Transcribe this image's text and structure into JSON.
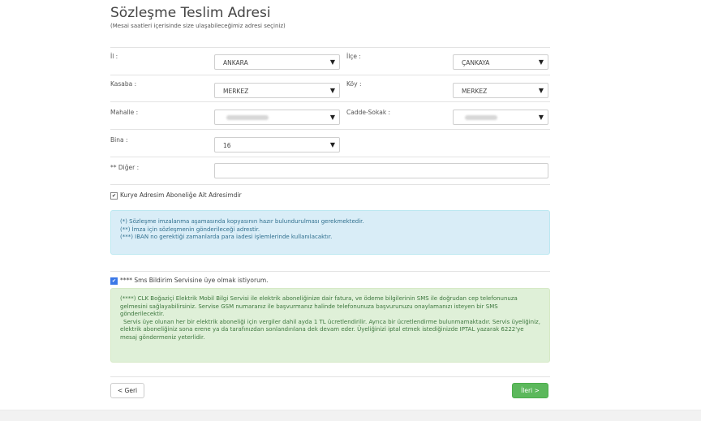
{
  "title": "Sözleşme Teslim Adresi",
  "subtitle": "(Mesai saatleri içerisinde size ulaşabileceğimiz adresi seçiniz)",
  "fields": {
    "il": {
      "label": "İl :",
      "value": "ANKARA"
    },
    "ilce": {
      "label": "İlçe :",
      "value": "ÇANKAYA"
    },
    "kasaba": {
      "label": "Kasaba :",
      "value": "MERKEZ"
    },
    "koy": {
      "label": "Köy :",
      "value": "MERKEZ"
    },
    "mahalle": {
      "label": "Mahalle :",
      "value": ""
    },
    "cadde": {
      "label": "Cadde-Sokak :",
      "value": ""
    },
    "bina": {
      "label": "Bina :",
      "value": "16"
    },
    "diger": {
      "label": "** Diğer :",
      "value": ""
    }
  },
  "kurye_checkbox": {
    "label": "Kurye Adresim Aboneliğe Ait Adresimdir",
    "checked": true
  },
  "info_lines": [
    "(*) Sözleşme imzalanma aşamasında kopyasının hazır bulundurulması gerekmektedir.",
    "(**) İmza için sözleşmenin gönderileceği adrestir.",
    "(***) IBAN no gerektiği zamanlarda para iadesi işlemlerinde kullanılacaktır."
  ],
  "sms_checkbox": {
    "label": "**** Sms Bildirim Servisine üye olmak istiyorum.",
    "checked": true
  },
  "sms_text_1": "(****) CLK Boğaziçi Elektrik Mobil Bilgi Servisi ile elektrik aboneliğinize dair fatura, ve ödeme bilgilerinin SMS ile doğrudan cep telefonunuza gelmesini sağlayabilirsiniz. Servise GSM numaranız ile başvurmanız halinde telefonunuza başvurunuzu onaylamanızı isteyen bir SMS gönderilecektir.",
  "sms_text_2": "Servis üye olunan her bir elektrik aboneliği için vergiler dahil ayda 1 TL ücretlendirilir. Ayrıca bir ücretlendirme bulunmamaktadır. Servis üyeliğiniz, elektrik aboneliğiniz sona erene ya da tarafınızdan sonlandırılana dek devam eder. Üyeliğinizi iptal etmek istediğinizde IPTAL yazarak 6222'ye mesaj göndermeniz yeterlidir.",
  "buttons": {
    "back": "< Geri",
    "next": "İleri >"
  },
  "icons": {
    "dropdown": "triangle-down-icon",
    "checkbox": "checkmark-icon"
  },
  "colors": {
    "info_bg": "#d9edf7",
    "success_bg": "#dff0d8",
    "next_button": "#5cb85c"
  }
}
